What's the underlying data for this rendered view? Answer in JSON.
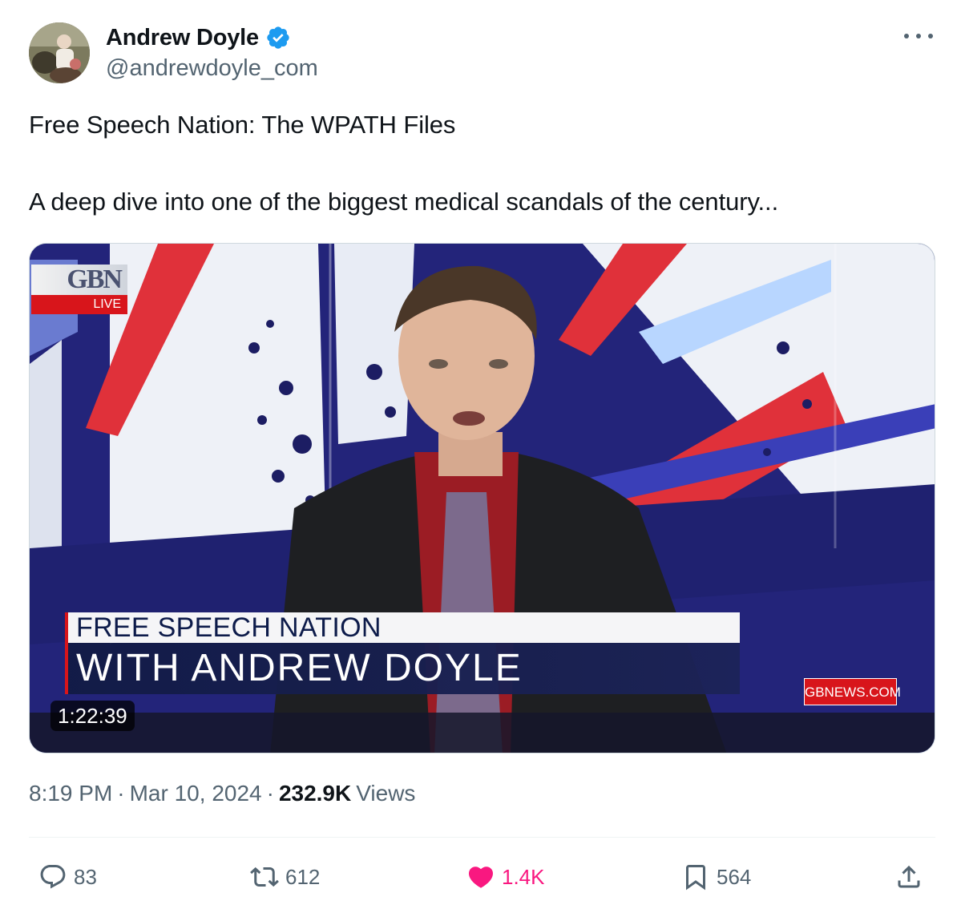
{
  "author": {
    "display_name": "Andrew Doyle",
    "handle": "@andrewdoyle_com",
    "verified": true,
    "verified_color": "#1d9bf0"
  },
  "icons": {
    "more": "more-horizontal-icon",
    "reply": "reply-icon",
    "retweet": "retweet-icon",
    "like": "heart-icon",
    "bookmark": "bookmark-icon",
    "share": "share-icon"
  },
  "tweet": {
    "line1": "Free Speech Nation: The WPATH Files",
    "line2": "A deep dive into one of the biggest medical scandals of the century..."
  },
  "media": {
    "logo_text": "GBN",
    "live_label": "LIVE",
    "lower_third_top": "FREE SPEECH NATION",
    "lower_third_bottom": "WITH ANDREW DOYLE",
    "channel_url": "GBNEWS.COM",
    "duration": "1:22:39"
  },
  "meta": {
    "time": "8:19 PM",
    "date": "Mar 10, 2024",
    "separator": "·",
    "views_count": "232.9K",
    "views_label": "Views"
  },
  "actions": {
    "replies": "83",
    "retweets": "612",
    "likes": "1.4K",
    "bookmarks": "564"
  },
  "colors": {
    "text_primary": "#0f1419",
    "text_secondary": "#536471",
    "like_pink": "#f91880",
    "gb_red": "#d8151b",
    "gb_navy": "#23247a"
  }
}
